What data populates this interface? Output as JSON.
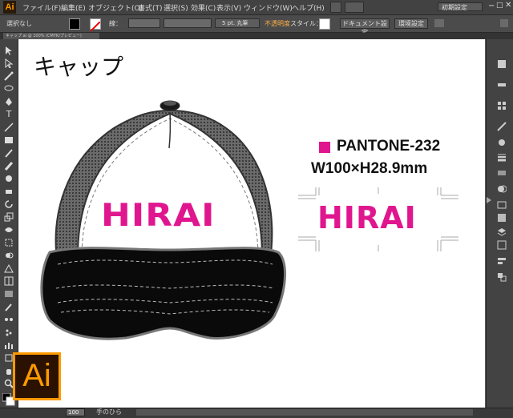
{
  "app": {
    "logo": "Ai"
  },
  "menu": {
    "items": [
      "ファイル(F)",
      "編集(E)",
      "オブジェクト(O)",
      "書式(T)",
      "選択(S)",
      "効果(C)",
      "表示(V)",
      "ウィンドウ(W)",
      "ヘルプ(H)"
    ],
    "workspace": "初期設定"
  },
  "control": {
    "selection": "選択なし",
    "stroke_label": "線：",
    "brush": "5 pt. 丸筆",
    "opacity": "不透明度",
    "style": "スタイル：",
    "doc_settings": "ドキュメント設定",
    "env_settings": "環境設定"
  },
  "document": {
    "tab": "キャップ.ai @ 100% (CMYK/プレビュー)"
  },
  "canvas": {
    "title": "キャップ",
    "pantone": "PANTONE-232",
    "pantone_color": "#e0168f",
    "dimensions": "W100×H28.9mm",
    "cap_text": "HIRAI",
    "logo_text": "HIRAI"
  },
  "status": {
    "zoom": "100",
    "tool": "手のひら"
  },
  "badge": {
    "label": "Ai"
  }
}
